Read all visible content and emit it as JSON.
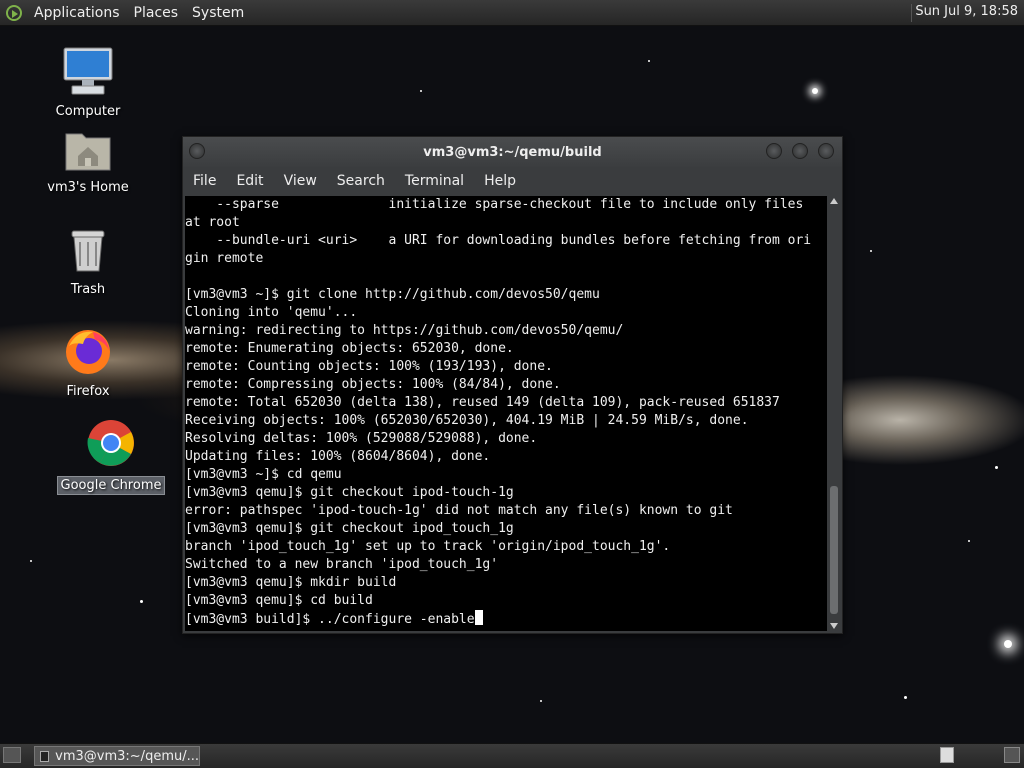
{
  "top_panel": {
    "menus": [
      "Applications",
      "Places",
      "System"
    ],
    "clock": "Sun Jul  9, 18:58"
  },
  "desktop": {
    "icons": [
      {
        "label": "Computer",
        "icon": "computer-icon"
      },
      {
        "label": "vm3's Home",
        "icon": "home-folder-icon"
      },
      {
        "label": "Trash",
        "icon": "trash-icon"
      },
      {
        "label": "Firefox",
        "icon": "firefox-icon"
      },
      {
        "label": "Google Chrome",
        "icon": "chrome-icon"
      }
    ]
  },
  "window": {
    "title": "vm3@vm3:~/qemu/build",
    "menu": [
      "File",
      "Edit",
      "View",
      "Search",
      "Terminal",
      "Help"
    ],
    "terminal_lines": [
      "    --sparse              initialize sparse-checkout file to include only files",
      "at root",
      "    --bundle-uri <uri>    a URI for downloading bundles before fetching from ori",
      "gin remote",
      "",
      "[vm3@vm3 ~]$ git clone http://github.com/devos50/qemu",
      "Cloning into 'qemu'...",
      "warning: redirecting to https://github.com/devos50/qemu/",
      "remote: Enumerating objects: 652030, done.",
      "remote: Counting objects: 100% (193/193), done.",
      "remote: Compressing objects: 100% (84/84), done.",
      "remote: Total 652030 (delta 138), reused 149 (delta 109), pack-reused 651837",
      "Receiving objects: 100% (652030/652030), 404.19 MiB | 24.59 MiB/s, done.",
      "Resolving deltas: 100% (529088/529088), done.",
      "Updating files: 100% (8604/8604), done.",
      "[vm3@vm3 ~]$ cd qemu",
      "[vm3@vm3 qemu]$ git checkout ipod-touch-1g",
      "error: pathspec 'ipod-touch-1g' did not match any file(s) known to git",
      "[vm3@vm3 qemu]$ git checkout ipod_touch_1g",
      "branch 'ipod_touch_1g' set up to track 'origin/ipod_touch_1g'.",
      "Switched to a new branch 'ipod_touch_1g'",
      "[vm3@vm3 qemu]$ mkdir build",
      "[vm3@vm3 qemu]$ cd build"
    ],
    "prompt_line": "[vm3@vm3 build]$ ../configure -enable"
  },
  "bottom_panel": {
    "task_label": "vm3@vm3:~/qemu/..."
  }
}
